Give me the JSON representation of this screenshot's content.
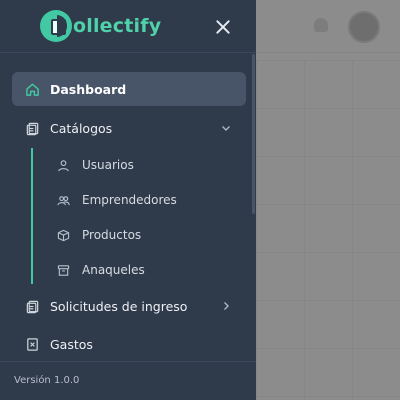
{
  "app": {
    "name": "ollectify",
    "logo_letter": "C"
  },
  "nav": {
    "dashboard": "Dashboard",
    "catalogos": "Catálogos",
    "sub": {
      "usuarios": "Usuarios",
      "emprendedores": "Emprendedores",
      "productos": "Productos",
      "anaqueles": "Anaqueles"
    },
    "solicitudes": "Solicitudes de ingreso",
    "gastos": "Gastos"
  },
  "footer": {
    "version": "Versión 1.0.0"
  },
  "colors": {
    "accent": "#42c9a3",
    "drawer_bg": "#2f3a4b",
    "active_bg": "#485467",
    "backdrop": "#8c8c8c"
  },
  "icons": {
    "dashboard": "home-icon",
    "catalogos": "clipboard-icon",
    "usuarios": "user-icon",
    "emprendedores": "users-icon",
    "productos": "box-icon",
    "anaqueles": "archive-icon",
    "solicitudes": "clipboard-icon",
    "gastos": "receipt-icon"
  }
}
